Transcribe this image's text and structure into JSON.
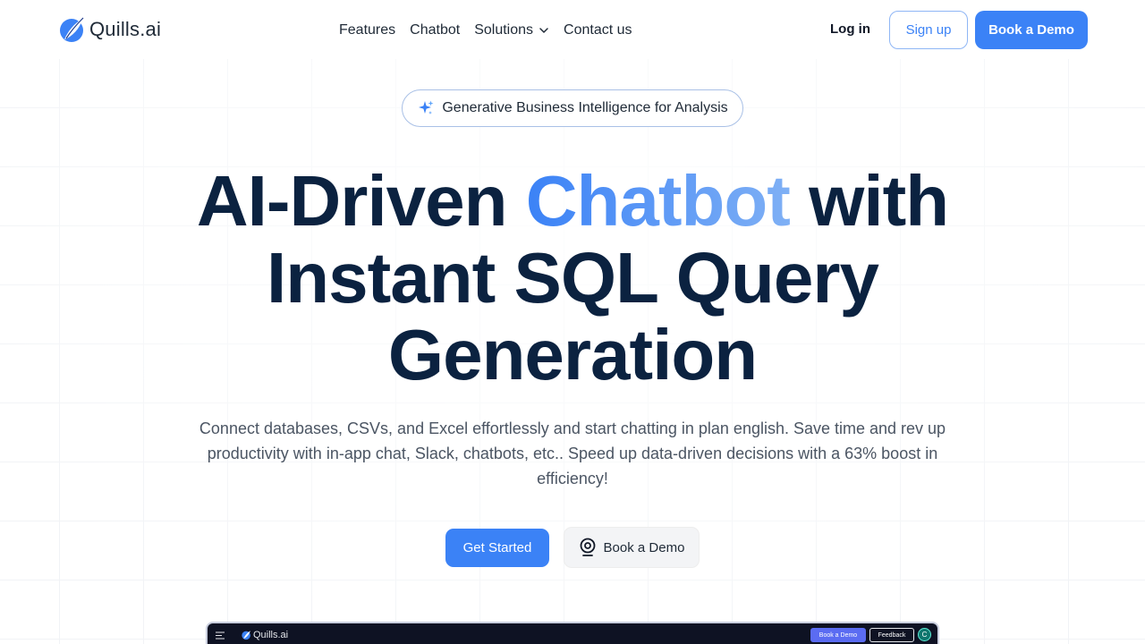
{
  "header": {
    "logo_text": "Quills.ai",
    "nav": [
      {
        "label": "Features",
        "dropdown": false
      },
      {
        "label": "Chatbot",
        "dropdown": false
      },
      {
        "label": "Solutions",
        "dropdown": true
      },
      {
        "label": "Contact us",
        "dropdown": false
      }
    ],
    "login_label": "Log in",
    "signup_label": "Sign up",
    "book_demo_label": "Book a Demo"
  },
  "hero": {
    "badge_icon": "sparkle-icon",
    "badge_text": "Generative Business Intelligence for Analysis",
    "headline_before": "AI-Driven ",
    "headline_accent": "Chatbot",
    "headline_after": " with Instant SQL Query Generation",
    "subtext": "Connect databases, CSVs, and Excel effortlessly and start chatting in plan english. Save time and rev up productivity with in-app chat, Slack, chatbots, etc.. Speed up data-driven decisions with a 63% boost in efficiency!",
    "get_started_label": "Get Started",
    "book_demo_label": "Book a Demo",
    "book_demo_icon": "location-pin-icon"
  },
  "preview": {
    "logo_text": "Quills.ai",
    "book_demo_label": "Book a Demo",
    "feedback_label": "Feedback",
    "avatar_initial": "C"
  },
  "colors": {
    "accent": "#3b82f6",
    "headline": "#0b2240",
    "preview_bg": "#0e1223"
  }
}
